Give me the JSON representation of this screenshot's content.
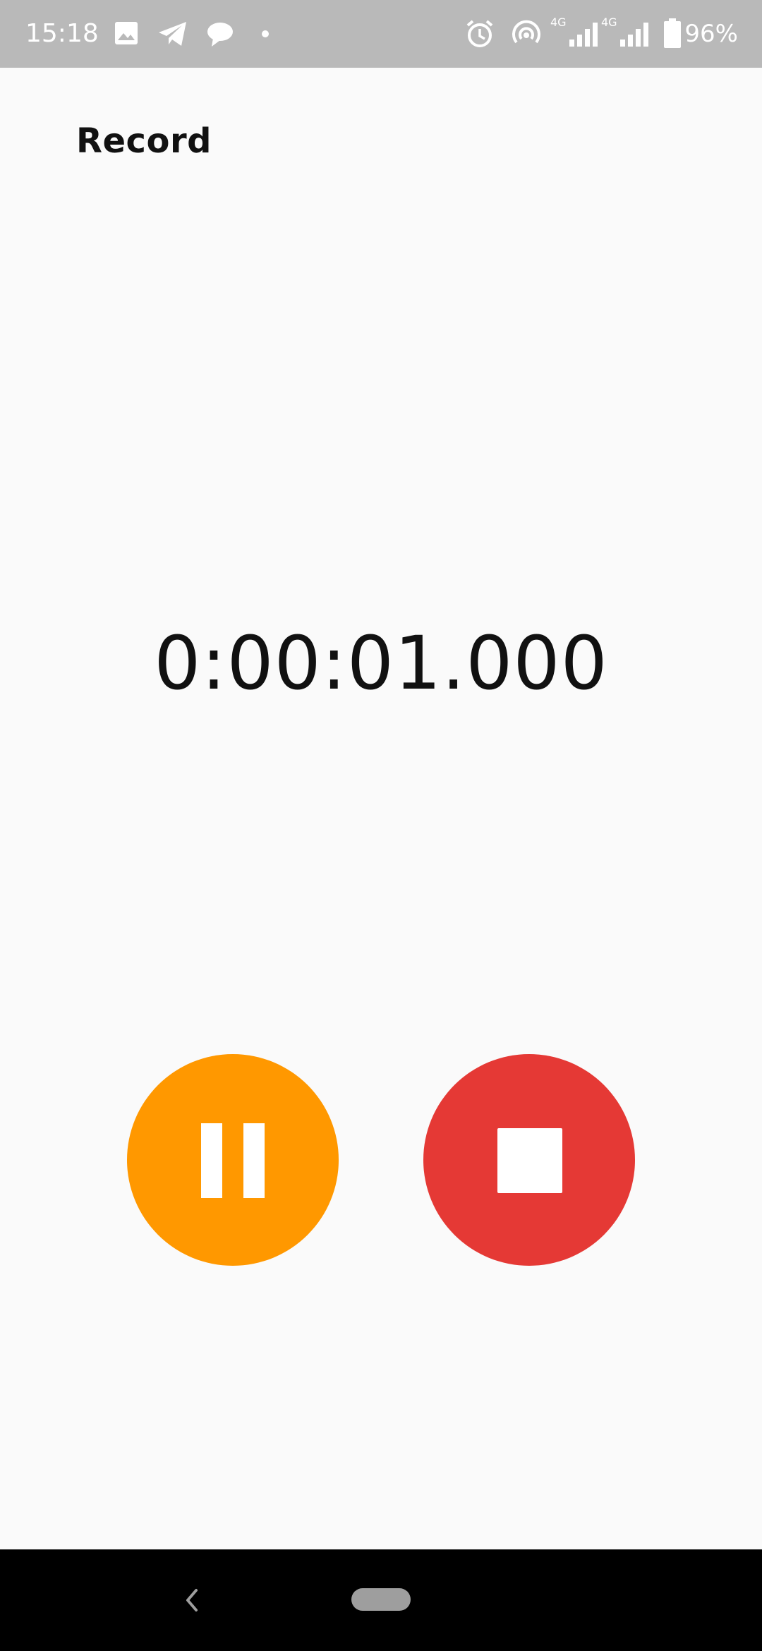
{
  "status_bar": {
    "time": "15:18",
    "battery_percent": "96%",
    "network_1": "4G",
    "network_2": "4G",
    "icons": [
      "gallery-icon",
      "telegram-icon",
      "chat-bubble-icon",
      "notification-dot-icon",
      "alarm-icon",
      "hotspot-icon",
      "signal-icon",
      "signal-icon",
      "battery-icon"
    ]
  },
  "header": {
    "title": "Record"
  },
  "timer": {
    "elapsed": "0:00:01.000"
  },
  "controls": {
    "pause_icon": "pause-icon",
    "stop_icon": "stop-icon",
    "pause_color": "#ff9800",
    "stop_color": "#e53935"
  },
  "nav_bar": {
    "back_icon": "back-chevron-icon",
    "home_icon": "home-pill-icon"
  }
}
